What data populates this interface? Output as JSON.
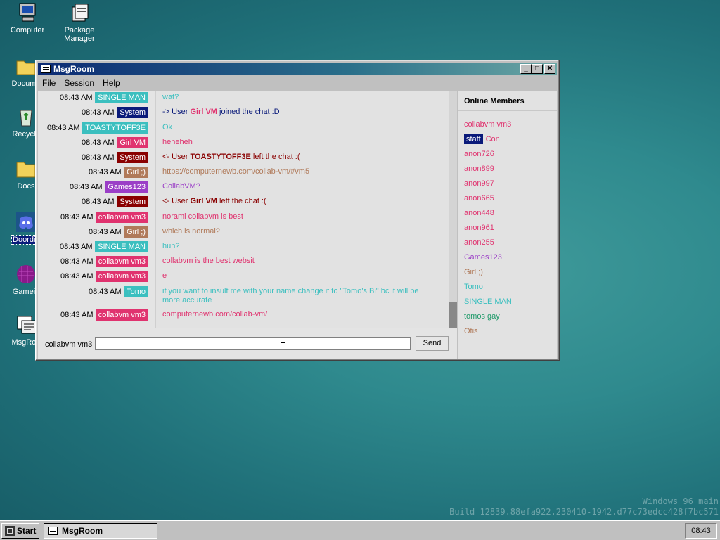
{
  "desktop": {
    "icons": [
      {
        "label": "Computer",
        "icon": "computer-icon"
      },
      {
        "label": "Package Manager",
        "icon": "package-manager-icon"
      },
      {
        "label": "Docume",
        "icon": "folder-icon"
      },
      {
        "label": "Recycle",
        "icon": "recycle-bin-icon"
      },
      {
        "label": "Docs",
        "icon": "folder-icon"
      },
      {
        "label": "Doordis",
        "icon": "discord-icon"
      },
      {
        "label": "Gamein",
        "icon": "game-icon"
      },
      {
        "label": "MsgRoo",
        "icon": "msgroom-icon"
      }
    ],
    "watermark_line1": "Windows 96 main",
    "watermark_line2": "Build 12839.88efa922.230410-1942.d77c73edcc428f7bc571"
  },
  "window": {
    "title": "MsgRoom",
    "menu": [
      "File",
      "Session",
      "Help"
    ],
    "messages": [
      {
        "time": "08:43 AM",
        "user": "SINGLE MAN",
        "color": "#3bbfbf",
        "text": "wat?",
        "text_color": "#3bbfbf"
      },
      {
        "time": "08:43 AM",
        "user": "System",
        "color": "#0a1a7a",
        "pre": "-> User ",
        "name": "Girl VM",
        "name_color": "#e0336f",
        "post": " joined the chat :D",
        "text_color": "#0a1a7a"
      },
      {
        "time": "08:43 AM",
        "user": "TOASTYTOFF3E",
        "color": "#3bbfbf",
        "text": "Ok",
        "text_color": "#3bbfbf"
      },
      {
        "time": "08:43 AM",
        "user": "Girl VM",
        "color": "#e0336f",
        "text": "heheheh",
        "text_color": "#e0336f"
      },
      {
        "time": "08:43 AM",
        "user": "System",
        "color": "#8a0000",
        "pre": "<- User ",
        "name": "TOASTYTOFF3E",
        "name_color": "#8a0000",
        "post": " left the chat :(",
        "text_color": "#8a0000"
      },
      {
        "time": "08:43 AM",
        "user": "Girl ;)",
        "color": "#b07a5a",
        "text": "https://computernewb.com/collab-vm/#vm5",
        "text_color": "#b07a5a"
      },
      {
        "time": "08:43 AM",
        "user": "Games123",
        "color": "#9b3fc7",
        "text": "CollabVM?",
        "text_color": "#9b3fc7"
      },
      {
        "time": "08:43 AM",
        "user": "System",
        "color": "#8a0000",
        "pre": "<- User ",
        "name": "Girl VM",
        "name_color": "#8a0000",
        "post": " left the chat :(",
        "text_color": "#8a0000"
      },
      {
        "time": "08:43 AM",
        "user": "collabvm vm3",
        "color": "#e0336f",
        "text": "noraml collabvm is best",
        "text_color": "#e0336f"
      },
      {
        "time": "08:43 AM",
        "user": "Girl ;)",
        "color": "#b07a5a",
        "text": "which is normal?",
        "text_color": "#b07a5a"
      },
      {
        "time": "08:43 AM",
        "user": "SINGLE MAN",
        "color": "#3bbfbf",
        "text": "huh?",
        "text_color": "#3bbfbf"
      },
      {
        "time": "08:43 AM",
        "user": "collabvm vm3",
        "color": "#e0336f",
        "text": "collabvm is the best websit",
        "text_color": "#e0336f"
      },
      {
        "time": "08:43 AM",
        "user": "collabvm vm3",
        "color": "#e0336f",
        "text": "e",
        "text_color": "#e0336f"
      },
      {
        "time": "08:43 AM",
        "user": "Tomo",
        "color": "#3bbfbf",
        "text": "if you want to insult me with your name change it to \"Tomo's Bi\" bc it will be more accurate",
        "text_color": "#3bbfbf"
      },
      {
        "time": "08:43 AM",
        "user": "collabvm vm3",
        "color": "#e0336f",
        "text": "computernewb.com/collab-vm/",
        "text_color": "#e0336f"
      }
    ],
    "members_title": "Online Members",
    "members": [
      {
        "name": "collabvm vm3",
        "color": "#e0336f"
      },
      {
        "name": "Con",
        "color": "#e0336f",
        "badge": "staff"
      },
      {
        "name": "anon726",
        "color": "#e0336f"
      },
      {
        "name": "anon899",
        "color": "#e0336f"
      },
      {
        "name": "anon997",
        "color": "#e0336f"
      },
      {
        "name": "anon665",
        "color": "#e0336f"
      },
      {
        "name": "anon448",
        "color": "#e0336f"
      },
      {
        "name": "anon961",
        "color": "#e0336f"
      },
      {
        "name": "anon255",
        "color": "#e0336f"
      },
      {
        "name": "Games123",
        "color": "#9b3fc7"
      },
      {
        "name": "Girl ;)",
        "color": "#b07a5a"
      },
      {
        "name": "Tomo",
        "color": "#3bbfbf"
      },
      {
        "name": "SINGLE MAN",
        "color": "#3bbfbf"
      },
      {
        "name": "tomos gay",
        "color": "#1f9a6a"
      },
      {
        "name": "Otis",
        "color": "#b07a5a"
      }
    ],
    "nickname": "collabvm vm3",
    "input_value": "",
    "send_label": "Send"
  },
  "taskbar": {
    "start_label": "Start",
    "task_label": "MsgRoom",
    "clock": "08:43"
  }
}
